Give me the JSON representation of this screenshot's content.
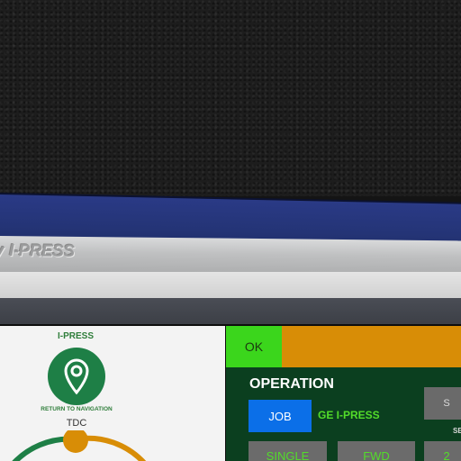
{
  "machine": {
    "brand_left": "y",
    "brand_right": "I-PRESS"
  },
  "navigation": {
    "title": "I-PRESS",
    "return_label": "RETURN TO NAVIGATION",
    "icon": "location-pin-icon"
  },
  "gauge": {
    "label": "TDC"
  },
  "status": {
    "ok_label": "OK",
    "ok_color": "#3bd61c",
    "bar_color": "#d88d06"
  },
  "operation": {
    "title": "OPERATION",
    "job_label": "JOB",
    "mode": "GE I-PRESS",
    "side_button_label": "S",
    "side_note": "SE",
    "single_label": "SINGLE",
    "fwd_label": "FWD",
    "third_label": "2"
  },
  "colors": {
    "accent_green": "#53dc2a",
    "job_blue": "#0b6fe8",
    "panel_green": "#0b3f1f",
    "nav_green": "#1e7f46"
  }
}
